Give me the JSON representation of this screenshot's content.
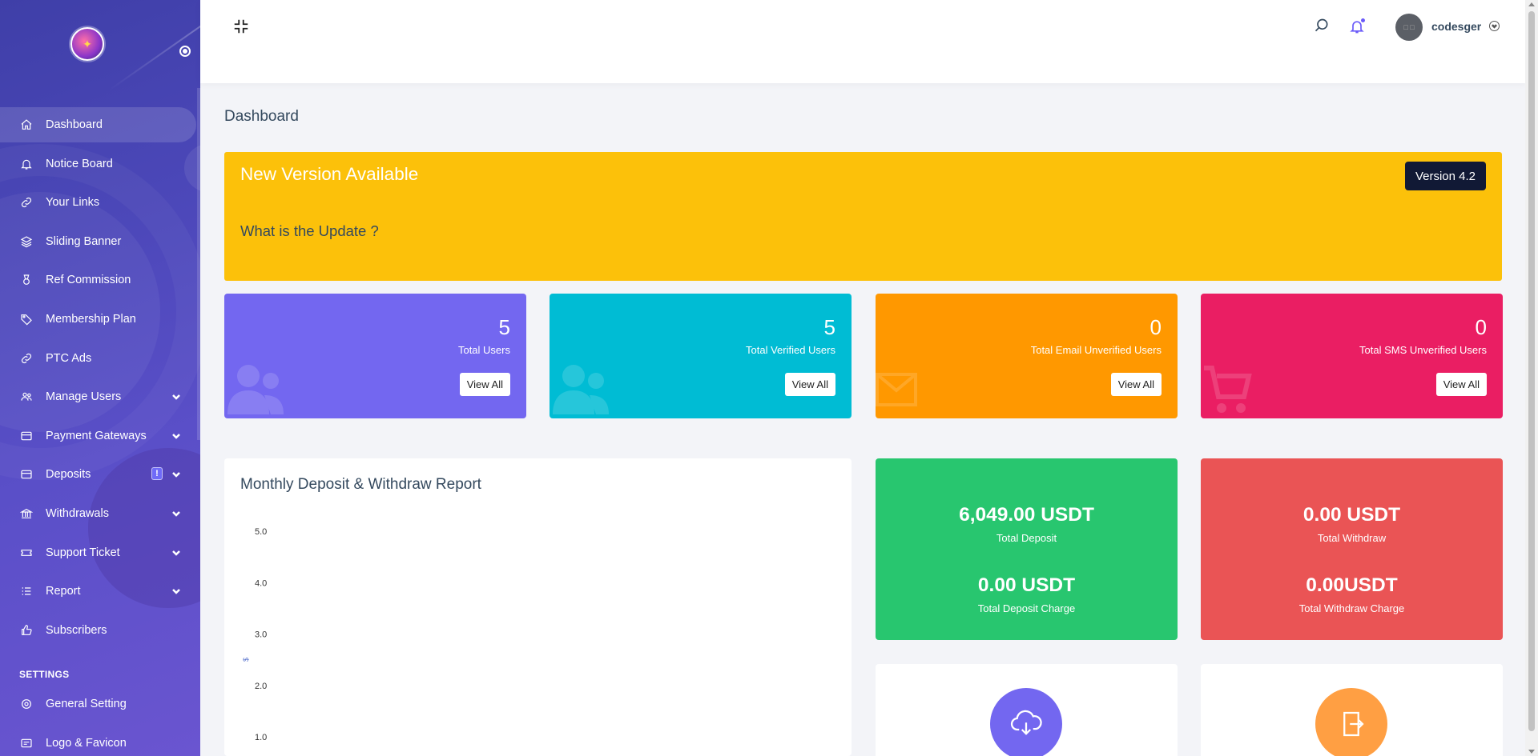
{
  "sidebar": {
    "items": [
      {
        "label": "Dashboard",
        "icon": "home-icon"
      },
      {
        "label": "Notice Board",
        "icon": "bell-icon"
      },
      {
        "label": "Your Links",
        "icon": "link-icon"
      },
      {
        "label": "Sliding Banner",
        "icon": "layers-icon"
      },
      {
        "label": "Ref Commission",
        "icon": "medal-icon"
      },
      {
        "label": "Membership Plan",
        "icon": "tag-icon"
      },
      {
        "label": "PTC Ads",
        "icon": "link-icon"
      },
      {
        "label": "Manage Users",
        "icon": "users-icon"
      },
      {
        "label": "Payment Gateways",
        "icon": "card-icon"
      },
      {
        "label": "Deposits",
        "icon": "card-icon",
        "badge": "!"
      },
      {
        "label": "Withdrawals",
        "icon": "bank-icon"
      },
      {
        "label": "Support Ticket",
        "icon": "ticket-icon"
      },
      {
        "label": "Report",
        "icon": "list-icon"
      },
      {
        "label": "Subscribers",
        "icon": "thumbs-up-icon"
      }
    ],
    "settings_heading": "SETTINGS",
    "settings_items": [
      {
        "label": "General Setting",
        "icon": "gear-icon"
      },
      {
        "label": "Logo & Favicon",
        "icon": "image-icon"
      }
    ]
  },
  "header": {
    "username": "codesger",
    "avatar_text": "□ □"
  },
  "page": {
    "title": "Dashboard"
  },
  "update_banner": {
    "title": "New Version Available",
    "subtitle": "What is the Update ?",
    "version_label": "Version 4.2"
  },
  "stat_cards": [
    {
      "value": "5",
      "label": "Total Users",
      "button": "View All",
      "color": "#7367f0"
    },
    {
      "value": "5",
      "label": "Total Verified Users",
      "button": "View All",
      "color": "#00bcd4"
    },
    {
      "value": "0",
      "label": "Total Email Unverified Users",
      "button": "View All",
      "color": "#ff9800"
    },
    {
      "value": "0",
      "label": "Total SMS Unverified Users",
      "button": "View All",
      "color": "#ea1e63"
    }
  ],
  "chart": {
    "title": "Monthly Deposit & Withdraw Report"
  },
  "chart_data": {
    "type": "line",
    "title": "Monthly Deposit & Withdraw Report",
    "ylabel": "$",
    "ylim": [
      0,
      5
    ],
    "y_ticks": [
      "5.0",
      "4.0",
      "3.0",
      "2.0",
      "1.0"
    ],
    "series": []
  },
  "money_cards": [
    {
      "value1": "6,049.00 USDT",
      "label1": "Total Deposit",
      "value2": "0.00 USDT",
      "label2": "Total Deposit Charge",
      "color": "#28c66f"
    },
    {
      "value1": "0.00 USDT",
      "label1": "Total Withdraw",
      "value2": "0.00USDT",
      "label2": "Total Withdraw Charge",
      "color": "#ea5455"
    }
  ],
  "icon_cards": [
    {
      "icon": "cloud-download-icon",
      "color": "#7367f0"
    },
    {
      "icon": "logout-icon",
      "color": "#ff9f43"
    }
  ]
}
